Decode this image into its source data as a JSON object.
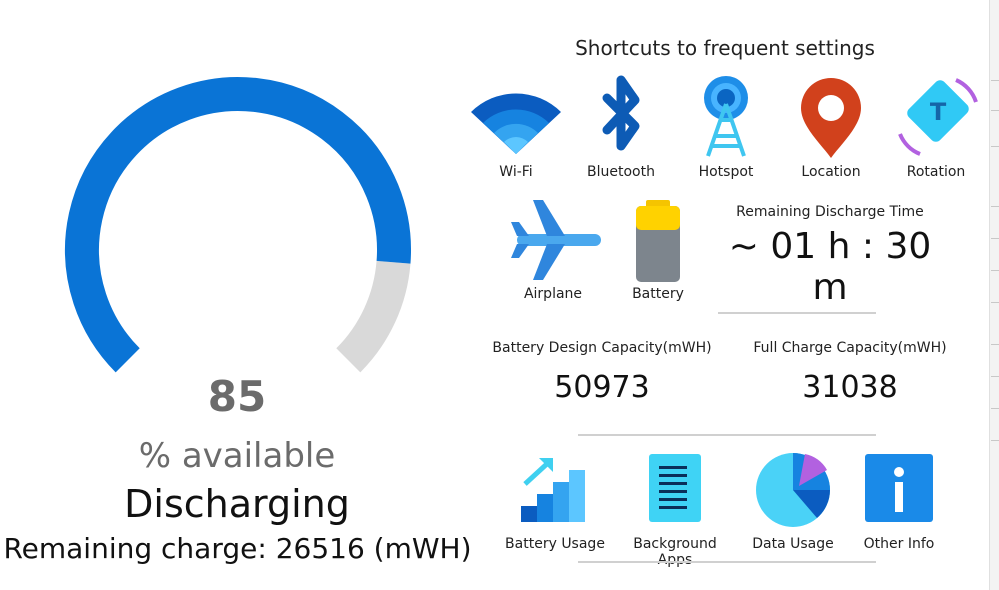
{
  "gauge": {
    "percent_value": "85",
    "percent_fraction": 0.85,
    "available_label": "% available",
    "state": "Discharging",
    "remaining_charge": "Remaining charge: 26516 (mWH)",
    "colors": {
      "fill": "#0a74d6",
      "track": "#d9d9d9"
    }
  },
  "shortcuts": {
    "title": "Shortcuts to frequent settings",
    "items": [
      {
        "label": "Wi-Fi",
        "icon": "wifi-icon"
      },
      {
        "label": "Bluetooth",
        "icon": "bluetooth-icon"
      },
      {
        "label": "Hotspot",
        "icon": "hotspot-icon"
      },
      {
        "label": "Location",
        "icon": "location-icon"
      },
      {
        "label": "Rotation",
        "icon": "rotation-icon"
      },
      {
        "label": "Airplane",
        "icon": "airplane-icon"
      },
      {
        "label": "Battery",
        "icon": "battery-icon"
      }
    ]
  },
  "discharge": {
    "label": "Remaining Discharge Time",
    "value": "~ 01 h : 30 m"
  },
  "capacity": {
    "design_label": "Battery Design Capacity(mWH)",
    "design_value": "50973",
    "full_label": "Full Charge Capacity(mWH)",
    "full_value": "31038"
  },
  "bottom": {
    "items": [
      {
        "label": "Battery Usage",
        "icon": "battery-usage-icon"
      },
      {
        "label": "Background Apps",
        "icon": "background-apps-icon"
      },
      {
        "label": "Data Usage",
        "icon": "data-usage-icon"
      },
      {
        "label": "Other Info",
        "icon": "info-icon"
      }
    ]
  }
}
